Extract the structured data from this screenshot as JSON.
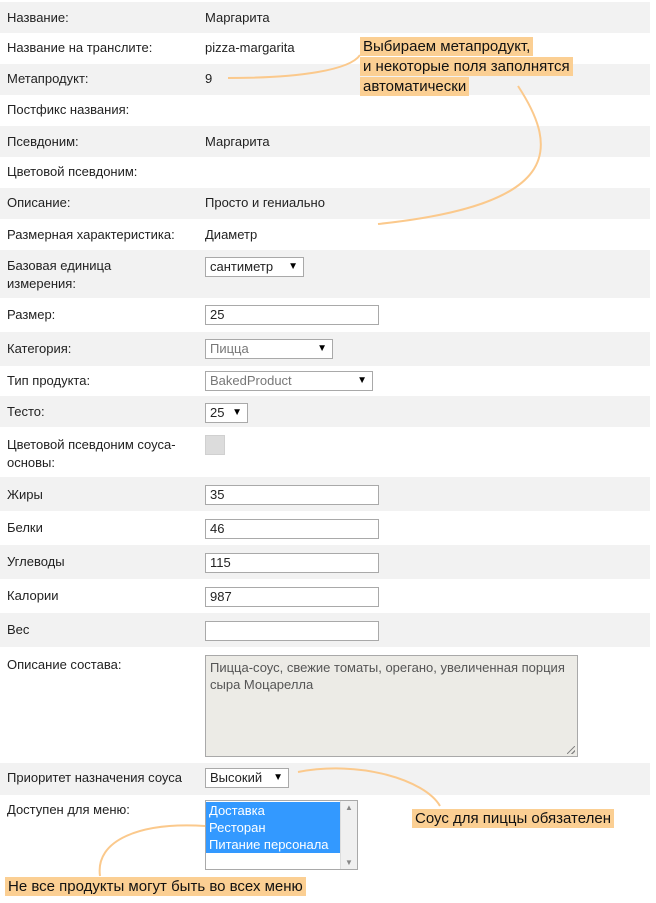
{
  "fields": {
    "name": {
      "label": "Название:",
      "value": "Маргарита"
    },
    "translit": {
      "label": "Название на транслите:",
      "value": "pizza-margarita"
    },
    "metaproduct": {
      "label": "Метапродукт:",
      "value": "9"
    },
    "postfix": {
      "label": "Постфикс названия:"
    },
    "alias": {
      "label": "Псевдоним:",
      "value": "Маргарита"
    },
    "color_alias": {
      "label": "Цветовой псевдоним:"
    },
    "description": {
      "label": "Описание:",
      "value": "Просто и гениально"
    },
    "size_char": {
      "label": "Размерная характеристика:",
      "value": "Диаметр"
    },
    "base_unit": {
      "label": "Базовая единица измерения:",
      "value": "сантиметр"
    },
    "size": {
      "label": "Размер:",
      "value": "25"
    },
    "category": {
      "label": "Категория:",
      "value": "Пицца"
    },
    "product_type": {
      "label": "Тип продукта:",
      "value": "BakedProduct"
    },
    "dough": {
      "label": "Тесто:",
      "value": "25"
    },
    "sauce_color_alias": {
      "label": "Цветовой псевдоним соуса-основы:"
    },
    "fats": {
      "label": "Жиры",
      "value": "35"
    },
    "proteins": {
      "label": "Белки",
      "value": "46"
    },
    "carbs": {
      "label": "Углеводы",
      "value": "115"
    },
    "calories": {
      "label": "Калории",
      "value": "987"
    },
    "weight": {
      "label": "Вес",
      "value": ""
    },
    "composition": {
      "label": "Описание состава:",
      "value": "Пицца-соус, свежие томаты, орегано, увеличенная порция сыра Моцарелла"
    },
    "sauce_priority": {
      "label": "Приоритет назначения соуса",
      "value": "Высокий"
    },
    "menus": {
      "label": "Доступен для меню:",
      "options": [
        "Доставка",
        "Ресторан",
        "Питание персонала"
      ]
    }
  },
  "callouts": {
    "metaproduct": "Выбираем метапродукт, и некоторые поля заполнятся автоматически",
    "metaproduct_lines": [
      "Выбираем метапродукт,",
      "и некоторые поля заполнятся",
      "автоматически"
    ],
    "sauce": "Соус для пиццы обязателен",
    "menus": "Не все продукты могут быть во всех меню"
  },
  "colors": {
    "callout_bg": "#fbcf93",
    "curve": "#fbc98c",
    "row_alt": "#f2f2f2",
    "selected_option": "#3399ff"
  }
}
